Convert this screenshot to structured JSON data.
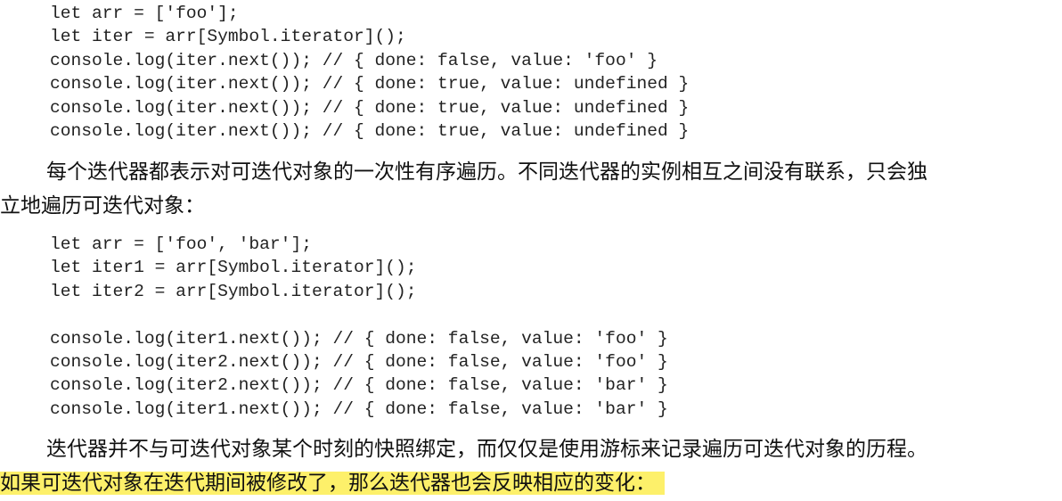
{
  "code_block_1": [
    "let arr = ['foo'];",
    "let iter = arr[Symbol.iterator]();",
    "console.log(iter.next()); // { done: false, value: 'foo' }",
    "console.log(iter.next()); // { done: true, value: undefined }",
    "console.log(iter.next()); // { done: true, value: undefined }",
    "console.log(iter.next()); // { done: true, value: undefined }"
  ],
  "paragraph_1": {
    "line_1": "每个迭代器都表示对可迭代对象的一次性有序遍历。不同迭代器的实例相互之间没有联系，只会独",
    "line_2": "立地遍历可迭代对象："
  },
  "code_block_2": [
    "let arr = ['foo', 'bar'];",
    "let iter1 = arr[Symbol.iterator]();",
    "let iter2 = arr[Symbol.iterator]();",
    "",
    "console.log(iter1.next()); // { done: false, value: 'foo' }",
    "console.log(iter2.next()); // { done: false, value: 'foo' }",
    "console.log(iter2.next()); // { done: false, value: 'bar' }",
    "console.log(iter1.next()); // { done: false, value: 'bar' }"
  ],
  "paragraph_2": {
    "line_1": "迭代器并不与可迭代对象某个时刻的快照绑定，而仅仅是使用游标来记录遍历可迭代对象的历程。",
    "line_2": "如果可迭代对象在迭代期间被修改了，那么迭代器也会反映相应的变化：",
    "highlight_color": "#fdf06a"
  }
}
